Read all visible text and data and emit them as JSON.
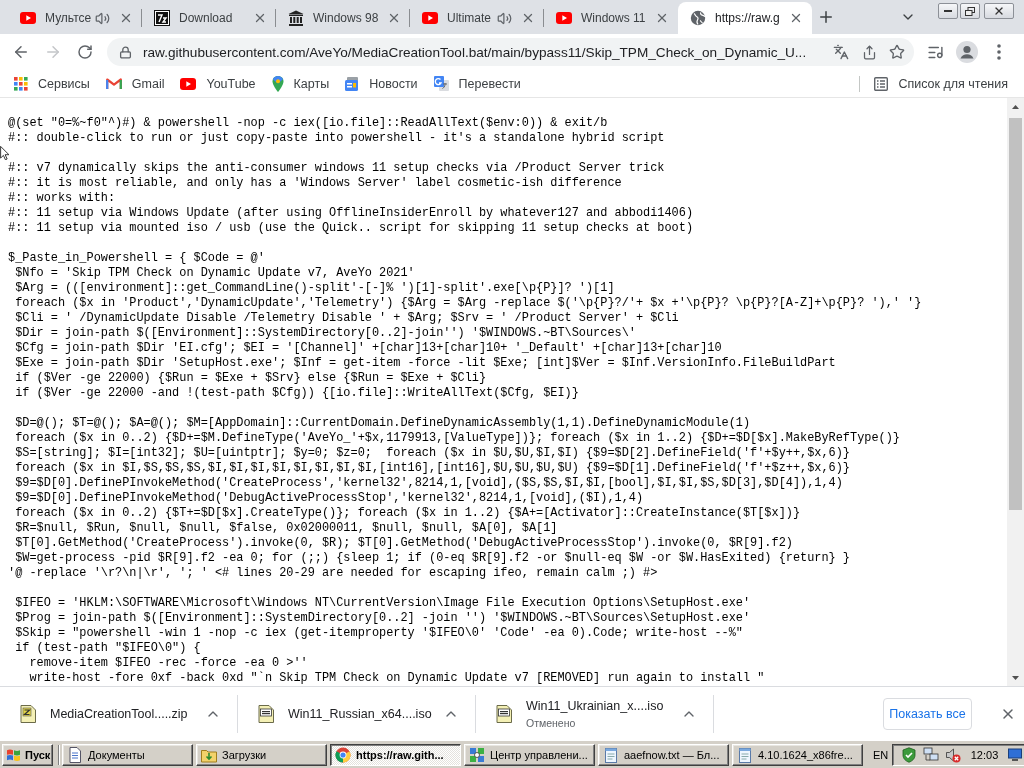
{
  "tabs": [
    {
      "title": "Мультсе",
      "kind": "youtube",
      "audio": true,
      "selected": false
    },
    {
      "title": "Download",
      "kind": "sevenzip",
      "audio": false,
      "selected": false
    },
    {
      "title": "Windows 98",
      "kind": "archive",
      "audio": false,
      "selected": false
    },
    {
      "title": "Ultimate",
      "kind": "youtube",
      "audio": true,
      "selected": false
    },
    {
      "title": "Windows 11",
      "kind": "youtube",
      "audio": false,
      "selected": false
    },
    {
      "title": "https://raw.g",
      "kind": "globe",
      "audio": false,
      "selected": true
    }
  ],
  "toolbar": {
    "url": "raw.githubusercontent.com/AveYo/MediaCreationTool.bat/main/bypass11/Skip_TPM_Check_on_Dynamic_U...",
    "forward_disabled": true
  },
  "bookmarks": {
    "items": [
      {
        "label": "Сервисы",
        "kind": "apps"
      },
      {
        "label": "Gmail",
        "kind": "gmail"
      },
      {
        "label": "YouTube",
        "kind": "youtube"
      },
      {
        "label": "Карты",
        "kind": "maps"
      },
      {
        "label": "Новости",
        "kind": "news"
      },
      {
        "label": "Перевести",
        "kind": "translate"
      }
    ],
    "reading_list": "Список для чтения"
  },
  "page": {
    "blocks": [
      [
        "@(set \"0=%~f0\"^)#) & powershell -nop -c iex([io.file]::ReadAllText($env:0)) & exit/b",
        "#:: double-click to run or just copy-paste into powershell - it's a standalone hybrid script"
      ],
      [
        "#:: v7 dynamically skips the anti-consumer windows 11 setup checks via /Product Server trick",
        "#:: it is most reliable, and only has a 'Windows Server' label cosmetic-ish difference",
        "#:: works with:",
        "#:: 11 setup via Windows Update (after using OfflineInsiderEnroll by whatever127 and abbodi1406)",
        "#:: 11 setup via mounted iso / usb (use the Quick.. script for skipping 11 setup checks at boot)"
      ],
      [
        "$_Paste_in_Powershell = { $Code = @'",
        " $Nfo = 'Skip TPM Check on Dynamic Update v7, AveYo 2021'",
        " $Arg = (([environment]::get_CommandLine()-split'-[-]% ')[1]-split'.exe[\\p{P}]? ')[1]",
        " foreach ($x in 'Product','DynamicUpdate','Telemetry') {$Arg = $Arg -replace $('\\p{P}?/'+ $x +'\\p{P}? \\p{P}?[A-Z]+\\p{P}? '),' '}",
        " $Cli = ' /DynamicUpdate Disable /Telemetry Disable ' + $Arg; $Srv = ' /Product Server' + $Cli",
        " $Dir = join-path $([Environment]::SystemDirectory[0..2]-join'') '$WINDOWS.~BT\\Sources\\'",
        " $Cfg = join-path $Dir 'EI.cfg'; $EI = '[Channel]' +[char]13+[char]10+ '_Default' +[char]13+[char]10",
        " $Exe = join-path $Dir 'SetupHost.exe'; $Inf = get-item -force -lit $Exe; [int]$Ver = $Inf.VersionInfo.FileBuildPart",
        " if ($Ver -ge 22000) {$Run = $Exe + $Srv} else {$Run = $Exe + $Cli}",
        " if ($Ver -ge 22000 -and !(test-path $Cfg)) {[io.file]::WriteAllText($Cfg, $EI)}"
      ],
      [
        " $D=@(); $T=@(); $A=@(); $M=[AppDomain]::CurrentDomain.DefineDynamicAssembly(1,1).DefineDynamicModule(1)",
        " foreach ($x in 0..2) {$D+=$M.DefineType('AveYo_'+$x,1179913,[ValueType])}; foreach ($x in 1..2) {$D+=$D[$x].MakeByRefType()}",
        " $S=[string]; $I=[int32]; $U=[uintptr]; $y=0; $z=0;  foreach ($x in $U,$U,$I,$I) {$9=$D[2].DefineField('f'+$y++,$x,6)}",
        " foreach ($x in $I,$S,$S,$S,$I,$I,$I,$I,$I,$I,$I,$I,[int16],[int16],$U,$U,$U,$U) {$9=$D[1].DefineField('f'+$z++,$x,6)}",
        " $9=$D[0].DefinePInvokeMethod('CreateProcess','kernel32',8214,1,[void],($S,$S,$I,$I,[bool],$I,$I,$S,$D[3],$D[4]),1,4)",
        " $9=$D[0].DefinePInvokeMethod('DebugActiveProcessStop','kernel32',8214,1,[void],($I),1,4)",
        " foreach ($x in 0..2) {$T+=$D[$x].CreateType()}; foreach ($x in 1..2) {$A+=[Activator]::CreateInstance($T[$x])}",
        " $R=$null, $Run, $null, $null, $false, 0x02000011, $null, $null, $A[0], $A[1]",
        " $T[0].GetMethod('CreateProcess').invoke(0, $R); $T[0].GetMethod('DebugActiveProcessStop').invoke(0, $R[9].f2)",
        " $W=get-process -pid $R[9].f2 -ea 0; for (;;) {sleep 1; if (0-eq $R[9].f2 -or $null-eq $W -or $W.HasExited) {return} }",
        "'@ -replace '\\r?\\n|\\r', '; ' <# lines 20-29 are needed for escaping ifeo, remain calm ;) #>"
      ],
      [
        " $IFEO = 'HKLM:\\SOFTWARE\\Microsoft\\Windows NT\\CurrentVersion\\Image File Execution Options\\SetupHost.exe'",
        " $Prog = join-path $([Environment]::SystemDirectory[0..2] -join '') '$WINDOWS.~BT\\Sources\\SetupHost.exe'",
        " $Skip = \"powershell -win 1 -nop -c iex (get-itemproperty '$IFEO\\0' 'Code' -ea 0).Code; write-host --%\"",
        " if (test-path \"$IFEO\\0\") {",
        "   remove-item $IFEO -rec -force -ea 0 >''",
        "   write-host -fore 0xf -back 0xd \"`n Skip TPM Check on Dynamic Update v7 [REMOVED] run again to install \""
      ]
    ]
  },
  "downloads": {
    "items": [
      {
        "name": "MediaCreationTool.....zip",
        "kind": "zip"
      },
      {
        "name": "Win11_Russian_x64....iso",
        "kind": "iso"
      },
      {
        "name": "Win11_Ukrainian_x....iso",
        "kind": "iso",
        "status": "Отменено"
      }
    ],
    "show_all": "Показать все"
  },
  "taskbar": {
    "start": "Пуск",
    "tasks": [
      {
        "label": "Документы",
        "kind": "document",
        "selected": false
      },
      {
        "label": "Загрузки",
        "kind": "folder",
        "selected": false
      },
      {
        "label": "https://raw.gith...",
        "kind": "browser",
        "selected": true
      },
      {
        "label": "Центр управлени...",
        "kind": "controlpanel",
        "selected": false
      },
      {
        "label": "aaefnow.txt — Бл...",
        "kind": "notepad",
        "selected": false
      },
      {
        "label": "4.10.1624_x86fre...",
        "kind": "notepad",
        "selected": false
      }
    ],
    "language": "EN",
    "clock": "12:03"
  }
}
